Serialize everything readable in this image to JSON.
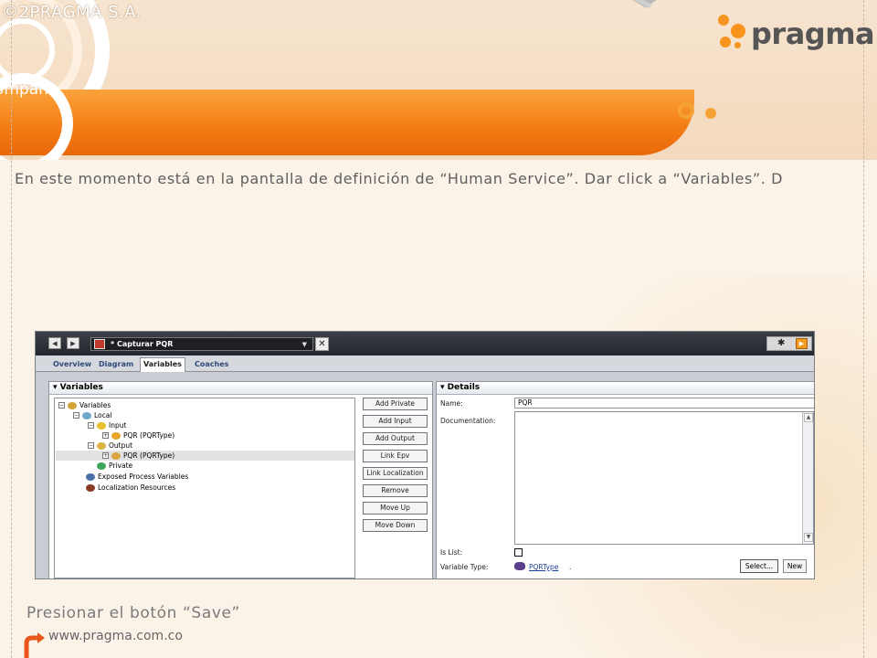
{
  "slide": {
    "copyright": "©2PRAGMA S.A.",
    "title_fragment": "ompan",
    "logo_text": "pragma",
    "instruction": "En este momento está en la pantalla de definición de “Human Service”.  Dar click a “Variables”.  D",
    "footer_instruction": "Presionar el botón “Save”",
    "footer_url": "www.pragma.com.co"
  },
  "app": {
    "nav": {
      "back_icon": "back-arrow-icon",
      "forward_icon": "forward-arrow-icon"
    },
    "editor_tab": {
      "title": "* Capturar PQR",
      "icon": "human-service-icon"
    },
    "tabs": [
      {
        "label": "Overview",
        "active": false
      },
      {
        "label": "Diagram",
        "active": false
      },
      {
        "label": "Variables",
        "active": true
      },
      {
        "label": "Coaches",
        "active": false
      }
    ],
    "variables_panel": {
      "title": "Variables",
      "tree": [
        {
          "label": "Variables",
          "level": 0,
          "expander": "−",
          "icon": "variables-icon"
        },
        {
          "label": "Local",
          "level": 1,
          "expander": "−",
          "icon": "local-icon"
        },
        {
          "label": "Input",
          "level": 2,
          "expander": "−",
          "icon": "input-icon"
        },
        {
          "label": "PQR (PQRType)",
          "level": 3,
          "expander": "+",
          "icon": "input-var-icon"
        },
        {
          "label": "Output",
          "level": 2,
          "expander": "−",
          "icon": "output-icon"
        },
        {
          "label": "PQR (PQRType)",
          "level": 3,
          "expander": "+",
          "icon": "output-var-icon",
          "selected": true
        },
        {
          "label": "Private",
          "level": 2,
          "expander": "",
          "icon": "private-icon"
        },
        {
          "label": "Exposed Process Variables",
          "level": 1,
          "expander": "",
          "icon": "exposed-process-variables-icon"
        },
        {
          "label": "Localization Resources",
          "level": 1,
          "expander": "",
          "icon": "localization-resources-icon"
        }
      ],
      "buttons": [
        "Add Private",
        "Add Input",
        "Add Output",
        "Link Epv",
        "Link Localization",
        "Remove",
        "Move Up",
        "Move Down"
      ]
    },
    "details_panel": {
      "title": "Details",
      "name_label": "Name:",
      "name_value": "PQR",
      "documentation_label": "Documentation:",
      "documentation_value": "",
      "is_list_label": "Is List:",
      "is_list_checked": false,
      "variable_type_label": "Variable Type:",
      "variable_type_value": "PQRType",
      "variable_type_suffix": ".",
      "select_button": "Select...",
      "new_button": "New"
    }
  }
}
